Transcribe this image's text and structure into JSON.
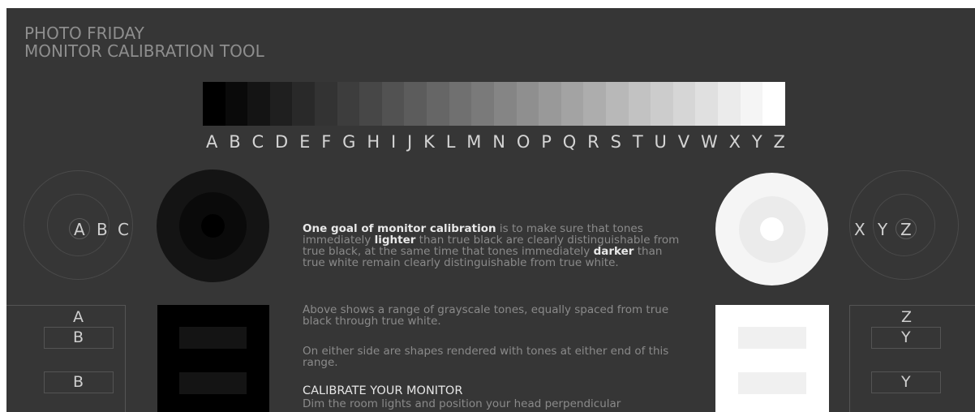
{
  "header": {
    "title_line1": "PHOTO FRIDAY",
    "title_line2": "MONITOR CALIBRATION TOOL"
  },
  "grayscale": {
    "letters": [
      "A",
      "B",
      "C",
      "D",
      "E",
      "F",
      "G",
      "H",
      "I",
      "J",
      "K",
      "L",
      "M",
      "N",
      "O",
      "P",
      "Q",
      "R",
      "S",
      "T",
      "U",
      "V",
      "W",
      "X",
      "Y",
      "Z"
    ],
    "colors": [
      "#000000",
      "#0a0a0a",
      "#141414",
      "#1f1f1f",
      "#292929",
      "#333333",
      "#3d3d3d",
      "#474747",
      "#525252",
      "#5c5c5c",
      "#666666",
      "#707070",
      "#7a7a7a",
      "#858585",
      "#8f8f8f",
      "#999999",
      "#a3a3a3",
      "#adadad",
      "#b8b8b8",
      "#c2c2c2",
      "#cccccc",
      "#d6d6d6",
      "#e0e0e0",
      "#ebebeb",
      "#f5f5f5",
      "#ffffff"
    ]
  },
  "left_ring": {
    "letters": [
      "A",
      "B",
      "C"
    ]
  },
  "right_ring": {
    "letters": [
      "X",
      "Y",
      "Z"
    ]
  },
  "dark_disc": {
    "outer": "#141414",
    "middle": "#0a0a0a",
    "inner": "#000000"
  },
  "light_disc": {
    "outer": "#f5f5f5",
    "middle": "#ebebeb",
    "inner": "#ffffff"
  },
  "text": {
    "para1_bold1": "One goal of monitor calibration",
    "para1_part1": " is to make sure that tones immediately ",
    "para1_bold2": "lighter",
    "para1_part2": " than true black are clearly distinguishable from true black, at the same time that tones immediately ",
    "para1_bold3": "darker",
    "para1_part3": " than true white remain clearly distinguishable from true white.",
    "para2": "Above shows a range of grayscale tones, equally spaced from true black through true white.",
    "para3": "On either side are shapes rendered with tones at either end of this range.",
    "calibrate_heading": "CALIBRATE YOUR MONITOR",
    "para4": "Dim the room lights and position your head perpendicular"
  },
  "left_box": {
    "letters": [
      "A",
      "B",
      "B"
    ]
  },
  "right_box": {
    "letters": [
      "Z",
      "Y",
      "Y"
    ]
  }
}
